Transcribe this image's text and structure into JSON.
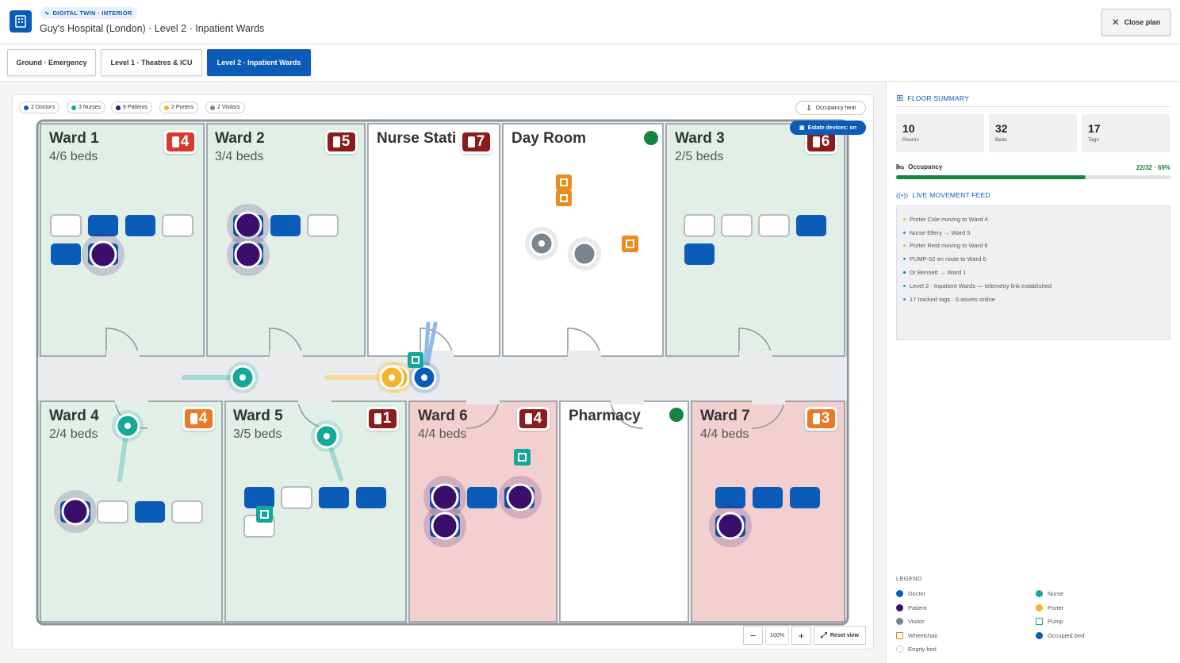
{
  "header": {
    "badge": "DIGITAL TWIN · INTERIOR",
    "title": "Guy's Hospital (London) · Level 2 · Inpatient Wards",
    "close_label": "Close plan"
  },
  "tabs": [
    {
      "label": "Ground · Emergency",
      "active": false
    },
    {
      "label": "Level 1 · Theatres & ICU",
      "active": false
    },
    {
      "label": "Level 2 · Inpatient Wards",
      "active": true
    }
  ],
  "filters": [
    {
      "label": "2 Doctors",
      "color": "#0a5cb8"
    },
    {
      "label": "3 Nurses",
      "color": "#14a89a"
    },
    {
      "label": "8 Patients",
      "color": "#3a0f6b"
    },
    {
      "label": "2 Porters",
      "color": "#f2b52b"
    },
    {
      "label": "2 Visitors",
      "color": "#7b8590"
    }
  ],
  "map": {
    "occupancy_heat_label": "Occupancy heat",
    "estate_devices_label": "Estate devices: on",
    "zoom": "100%",
    "zoom_out": "−",
    "zoom_in": "+",
    "reset_label": "Reset view",
    "rooms": [
      {
        "name": "Ward 1",
        "beds": "4/6 beds",
        "count": "4",
        "count_color": "#d93a2b"
      },
      {
        "name": "Ward 2",
        "beds": "3/4 beds",
        "count": "5",
        "count_color": "#8b1c1c"
      },
      {
        "name": "Nurse Stati",
        "beds": "",
        "count": "7",
        "count_color": "#8b1c1c"
      },
      {
        "name": "Day Room",
        "beds": "",
        "count": "",
        "count_color": ""
      },
      {
        "name": "Ward 3",
        "beds": "2/5 beds",
        "count": "6",
        "count_color": "#8b1c1c"
      },
      {
        "name": "Ward 4",
        "beds": "2/4 beds",
        "count": "4",
        "count_color": "#ea7a28"
      },
      {
        "name": "Ward 5",
        "beds": "3/5 beds",
        "count": "1",
        "count_color": "#8b1c1c"
      },
      {
        "name": "Ward 6",
        "beds": "4/4 beds",
        "count": "4",
        "count_color": "#8b1c1c"
      },
      {
        "name": "Pharmacy",
        "beds": "",
        "count": "",
        "count_color": ""
      },
      {
        "name": "Ward 7",
        "beds": "4/4 beds",
        "count": "3",
        "count_color": "#ea7a28"
      }
    ]
  },
  "summary": {
    "title": "FLOOR SUMMARY",
    "stats": [
      {
        "value": "10",
        "label": "Rooms"
      },
      {
        "value": "32",
        "label": "Beds"
      },
      {
        "value": "17",
        "label": "Tags"
      }
    ],
    "occupancy_label": "Occupancy",
    "occupancy_value": "22/32 · 69%",
    "occupancy_fraction": 0.69
  },
  "feed": {
    "title": "LIVE MOVEMENT FEED",
    "items": [
      {
        "text": "Porter Cole moving to Ward 4",
        "color": "#f2b52b"
      },
      {
        "text": "Nurse Ellery → Ward 5",
        "color": "#14a89a"
      },
      {
        "text": "Porter Reid moving to Ward 6",
        "color": "#f2b52b"
      },
      {
        "text": "PUMP-02 en route to Ward 6",
        "color": "#14a89a"
      },
      {
        "text": "Dr Bennett → Ward 1",
        "color": "#0a5cb8"
      },
      {
        "text": "Level 2 · Inpatient Wards — telemetry link established",
        "color": "#14a89a"
      },
      {
        "text": "17 tracked tags · 6 assets online",
        "color": "#14a89a"
      }
    ]
  },
  "legend": {
    "title": "LEGEND",
    "items": [
      {
        "label": "Doctor",
        "shape": "dot",
        "color": "#0a5cb8"
      },
      {
        "label": "Nurse",
        "shape": "dot",
        "color": "#14a89a"
      },
      {
        "label": "Patient",
        "shape": "dot",
        "color": "#3a0f6b"
      },
      {
        "label": "Porter",
        "shape": "dot",
        "color": "#f2b52b"
      },
      {
        "label": "Visitor",
        "shape": "dot",
        "color": "#7b8590"
      },
      {
        "label": "Pump",
        "shape": "square",
        "color": "#14a89a"
      },
      {
        "label": "Wheelchair",
        "shape": "square",
        "color": "#ea8c1c"
      },
      {
        "label": "Occupied bed",
        "shape": "dot",
        "color": "#0a5cb8"
      },
      {
        "label": "Empty bed",
        "shape": "ring",
        "color": "#c9c9c9"
      }
    ]
  }
}
